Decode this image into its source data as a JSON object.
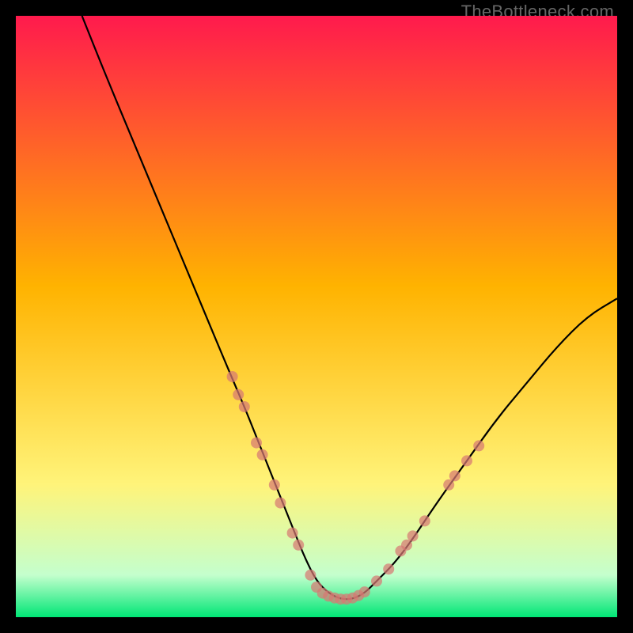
{
  "attribution": "TheBottleneck.com",
  "chart_data": {
    "type": "line",
    "title": "",
    "xlabel": "",
    "ylabel": "",
    "xlim": [
      0,
      100
    ],
    "ylim": [
      0,
      100
    ],
    "curve": {
      "x": [
        11,
        15,
        20,
        25,
        30,
        35,
        38,
        40,
        42,
        44,
        46,
        48,
        50,
        52,
        54,
        56,
        58,
        60,
        63,
        66,
        70,
        75,
        80,
        85,
        90,
        95,
        100
      ],
      "y": [
        100,
        90,
        78,
        66,
        54,
        42,
        35,
        30,
        25,
        20,
        15,
        10,
        6,
        4,
        3,
        3,
        4,
        6,
        9,
        13,
        19,
        26,
        33,
        39,
        45,
        50,
        53
      ]
    },
    "points_cluster": [
      {
        "x": 36,
        "y": 40
      },
      {
        "x": 37,
        "y": 37
      },
      {
        "x": 38,
        "y": 35
      },
      {
        "x": 40,
        "y": 29
      },
      {
        "x": 41,
        "y": 27
      },
      {
        "x": 43,
        "y": 22
      },
      {
        "x": 44,
        "y": 19
      },
      {
        "x": 46,
        "y": 14
      },
      {
        "x": 47,
        "y": 12
      },
      {
        "x": 49,
        "y": 7
      },
      {
        "x": 50,
        "y": 5
      },
      {
        "x": 51,
        "y": 4
      },
      {
        "x": 52,
        "y": 3.5
      },
      {
        "x": 53,
        "y": 3.2
      },
      {
        "x": 54,
        "y": 3
      },
      {
        "x": 55,
        "y": 3
      },
      {
        "x": 56,
        "y": 3.2
      },
      {
        "x": 57,
        "y": 3.6
      },
      {
        "x": 58,
        "y": 4.2
      },
      {
        "x": 60,
        "y": 6
      },
      {
        "x": 62,
        "y": 8
      },
      {
        "x": 64,
        "y": 11
      },
      {
        "x": 65,
        "y": 12
      },
      {
        "x": 66,
        "y": 13.5
      },
      {
        "x": 68,
        "y": 16
      },
      {
        "x": 72,
        "y": 22
      },
      {
        "x": 73,
        "y": 23.5
      },
      {
        "x": 75,
        "y": 26
      },
      {
        "x": 77,
        "y": 28.5
      }
    ],
    "background_gradient": {
      "top": "#ff1a4d",
      "upper_mid": "#ffb300",
      "lower_mid": "#fff47a",
      "near_bottom": "#c4ffcd",
      "bottom": "#00e676"
    }
  }
}
